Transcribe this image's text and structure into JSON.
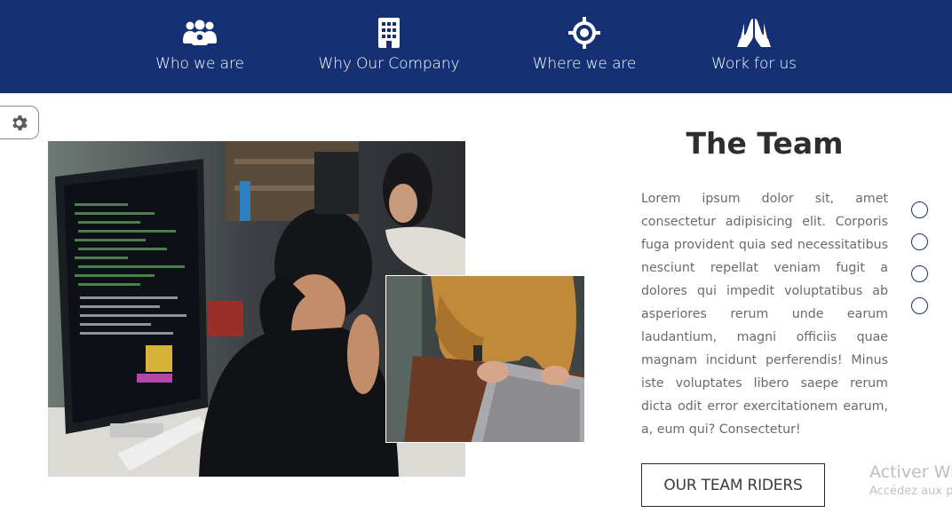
{
  "nav": {
    "items": [
      {
        "label": "Who we are",
        "icon": "people-group-icon"
      },
      {
        "label": "Why Our Company",
        "icon": "building-icon"
      },
      {
        "label": "Where we are",
        "icon": "location-crosshair-icon"
      },
      {
        "label": "Work for us",
        "icon": "praying-hands-icon"
      }
    ]
  },
  "settings": {
    "icon": "gear-icon"
  },
  "team": {
    "title": "The Team",
    "body": "Lorem ipsum dolor sit, amet consectetur adipisicing elit. Corporis fuga provident quia sed necessitatibus nesciunt repellat veniam fugit a dolores qui impedit voluptatibus ab asperiores rerum unde earum laudantium, magni officiis quae magnam incidunt perferendis! Minus iste voluptates libero saepe rerum dicta odit error exercitationem earum, a, eum qui? Consectetur!",
    "button_label": "OUR TEAM RIDERS"
  },
  "slider": {
    "dot_count": 4
  },
  "watermark": {
    "title": "Activer Windows",
    "subtitle": "Accédez aux paramètres"
  },
  "colors": {
    "nav_background": "#163173",
    "dot_border": "#1a2f66",
    "title_text": "#2e2e2e",
    "body_text": "#6a6a6a"
  }
}
